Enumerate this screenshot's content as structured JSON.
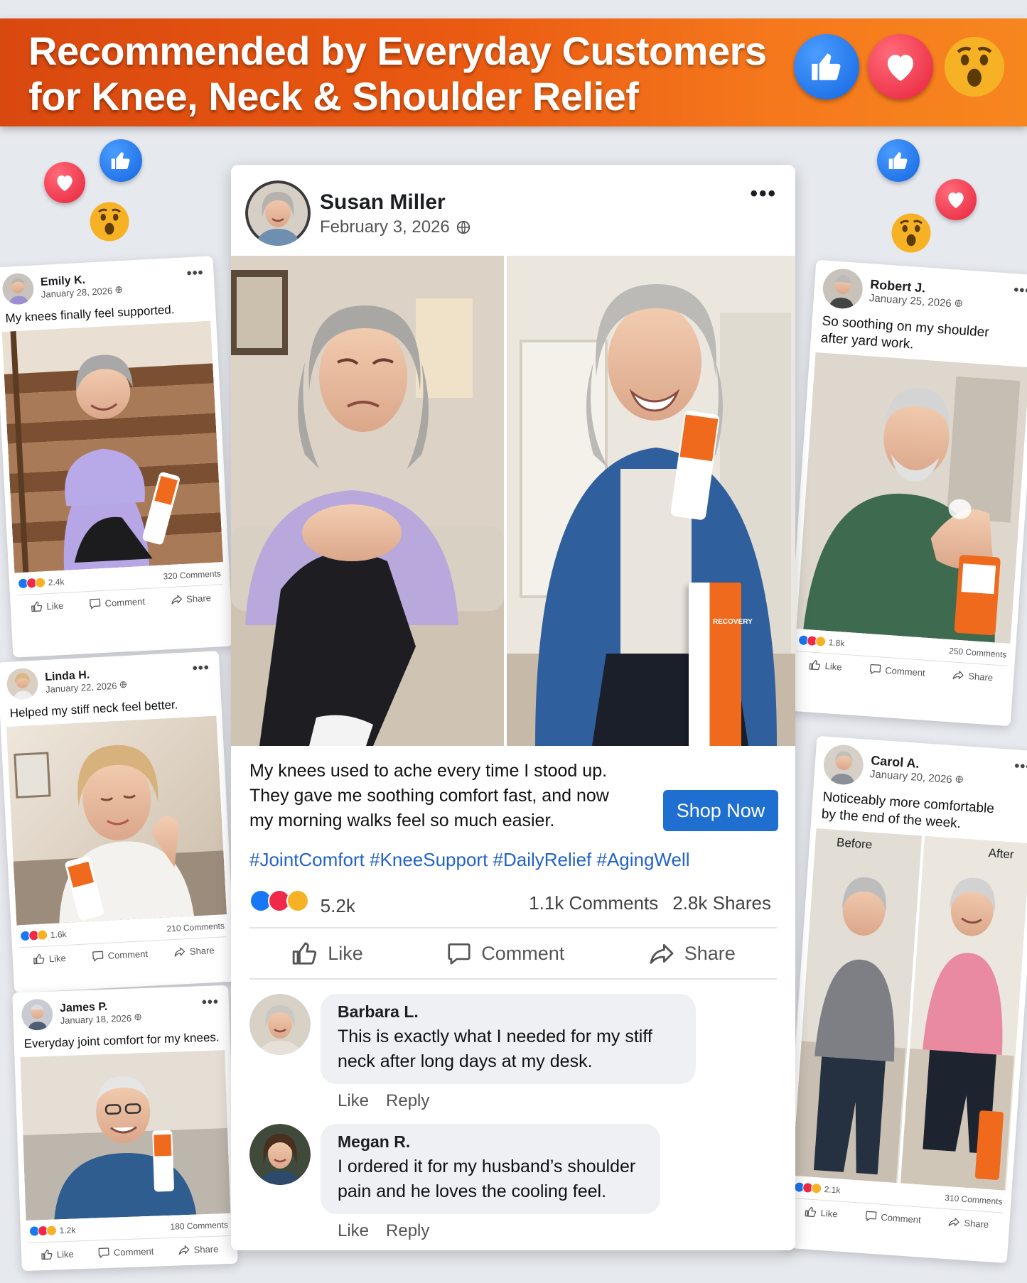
{
  "banner": {
    "title_line1": "Recommended by Everyday Customers",
    "title_line2": "for Knee, Neck & Shoulder Relief",
    "reactions": [
      "thumbs-up-icon",
      "heart-icon",
      "wow-face-icon"
    ]
  },
  "colors": {
    "like": "#1877f2",
    "love": "#f02849",
    "wow": "#f7b125",
    "banner": "#ea5a12",
    "shop_button": "#1f6fd1",
    "hashtag": "#2262c8"
  },
  "main_post": {
    "author": "Susan Miller",
    "date": "February 3, 2026",
    "text": "My knees used to ache every time I stood up. They gave me soothing comfort fast, and now my morning walks feel so much easier.",
    "cta": "Shop Now",
    "hashtags": "#JointComfort #KneeSupport #DailyRelief #AgingWell",
    "reaction_count": "5.2k",
    "comments_count": "1.1k Comments",
    "shares_count": "2.8k Shares",
    "actions": {
      "like": "Like",
      "comment": "Comment",
      "share": "Share"
    },
    "comments": [
      {
        "name": "Barbara L.",
        "text": "This is exactly what I needed for my stiff neck after long days at my desk.",
        "like": "Like",
        "reply": "Reply"
      },
      {
        "name": "Megan R.",
        "text": "I ordered it for my husband’s shoulder pain and he loves the cooling feel.",
        "like": "Like",
        "reply": "Reply"
      }
    ]
  },
  "side_posts": {
    "emily": {
      "name": "Emily K.",
      "date": "January 28, 2026",
      "text": "My knees finally feel supported.",
      "reactions": "2.4k",
      "comments": "320 Comments",
      "like": "Like",
      "comment": "Comment",
      "share": "Share"
    },
    "linda": {
      "name": "Linda H.",
      "date": "January 22, 2026",
      "text": "Helped my stiff neck feel better.",
      "reactions": "1.6k",
      "comments": "210 Comments",
      "like": "Like",
      "comment": "Comment",
      "share": "Share"
    },
    "james": {
      "name": "James P.",
      "date": "January 18, 2026",
      "text": "Everyday joint comfort for my knees.",
      "reactions": "1.2k",
      "comments": "180 Comments",
      "like": "Like",
      "comment": "Comment",
      "share": "Share"
    },
    "robert": {
      "name": "Robert J.",
      "date": "January 25, 2026",
      "text": "So soothing on my shoulder after yard work.",
      "reactions": "1.8k",
      "comments": "250 Comments",
      "like": "Like",
      "comment": "Comment",
      "share": "Share"
    },
    "carol": {
      "name": "Carol A.",
      "date": "January 20, 2026",
      "text": "Noticeably more comfortable by the end of the week.",
      "before": "Before",
      "after": "After",
      "reactions": "2.1k",
      "comments": "310 Comments",
      "like": "Like",
      "comment": "Comment",
      "share": "Share"
    }
  },
  "product": {
    "label": "RECOVERY"
  }
}
